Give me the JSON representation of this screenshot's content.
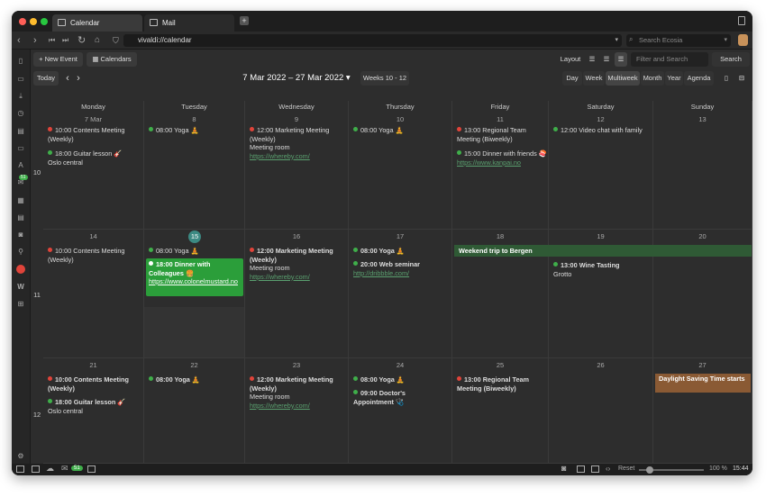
{
  "tabs": [
    {
      "label": "Calendar"
    },
    {
      "label": "Mail"
    }
  ],
  "url": "vivaldi://calendar",
  "search_placeholder": "Search Ecosia",
  "toolbar": {
    "new_event": "New Event",
    "calendars": "Calendars",
    "layout": "Layout",
    "filter_placeholder": "Filter and Search",
    "search": "Search",
    "today": "Today",
    "range": "7 Mar 2022 – 27 Mar 2022",
    "weeks": "Weeks 10 - 12",
    "views": [
      "Day",
      "Week",
      "Multiweek",
      "Month",
      "Year",
      "Agenda"
    ]
  },
  "days": [
    "Monday",
    "Tuesday",
    "Wednesday",
    "Thursday",
    "Friday",
    "Saturday",
    "Sunday"
  ],
  "weeks": [
    {
      "num": "10",
      "dates": [
        "7 Mar",
        "8",
        "9",
        "10",
        "11",
        "12",
        "13"
      ]
    },
    {
      "num": "11",
      "dates": [
        "14",
        "15",
        "16",
        "17",
        "18",
        "19",
        "20"
      ]
    },
    {
      "num": "12",
      "dates": [
        "21",
        "22",
        "23",
        "24",
        "25",
        "26",
        "27"
      ]
    }
  ],
  "events": {
    "w10_mon_1": "10:00 Contents Meeting (Weekly)",
    "w10_mon_2": "18:00 Guitar lesson 🎸",
    "w10_mon_2_loc": "Oslo central",
    "w10_tue_1": "08:00 Yoga 🧘",
    "w10_wed_1": "12:00 Marketing Meeting (Weekly)",
    "w10_wed_1_loc": "Meeting room",
    "w10_wed_1_url": "https://whereby.com/",
    "w10_thu_1": "08:00 Yoga 🧘",
    "w10_fri_1": "13:00 Regional Team Meeting (Biweekly)",
    "w10_fri_2": "15:00 Dinner with friends 🍣",
    "w10_fri_2_url": "https://www.kanpai.no",
    "w10_sat_1": "12:00 Video chat with family",
    "w11_mon_1": "10:00 Contents Meeting (Weekly)",
    "w11_tue_1": "08:00 Yoga 🧘",
    "w11_tue_2": "18:00 Dinner with Colleagues 🍔",
    "w11_tue_2_url": "https://www.colonelmustard.no",
    "w11_wed_1": "12:00 Marketing Meeting (Weekly)",
    "w11_wed_1_loc": "Meeting room",
    "w11_wed_1_url": "https://whereby.com/",
    "w11_thu_1": "08:00 Yoga 🧘",
    "w11_thu_2": "20:00 Web seminar",
    "w11_thu_2_url": "http://dribbble.com/",
    "w11_trip": "Weekend trip to Bergen",
    "w11_sat_1": "13:00 Wine Tasting",
    "w11_sat_1_loc": "Grotto",
    "w12_mon_1": "10:00 Contents Meeting (Weekly)",
    "w12_mon_2": "18:00 Guitar lesson 🎸",
    "w12_mon_2_loc": "Oslo central",
    "w12_tue_1": "08:00 Yoga 🧘",
    "w12_wed_1": "12:00 Marketing Meeting (Weekly)",
    "w12_wed_1_loc": "Meeting room",
    "w12_wed_1_url": "https://whereby.com/",
    "w12_thu_1": "08:00 Yoga 🧘",
    "w12_thu_2": "09:00 Doctor's Appointment 🩺",
    "w12_fri_1": "13:00 Regional Team Meeting (Biweekly)",
    "w12_sun_1": "Daylight Saving Time starts"
  },
  "sidebar_badge": "51",
  "status": {
    "mail_badge": "51",
    "reset": "Reset",
    "zoom": "100 %",
    "time": "15:44"
  },
  "colors": {
    "red": "#e0443a",
    "green": "#3fae4a",
    "orange": "#e7a33b",
    "today": "#3c8a83"
  }
}
